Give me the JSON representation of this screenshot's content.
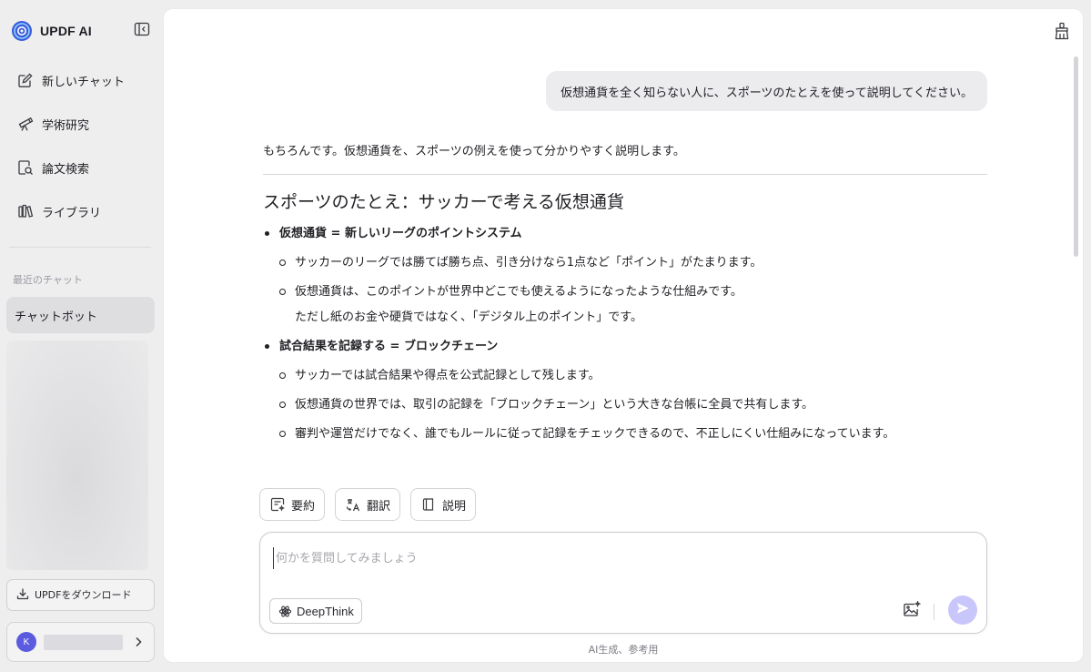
{
  "app": {
    "name": "UPDF AI"
  },
  "sidebar": {
    "nav": [
      {
        "label": "新しいチャット",
        "icon": "edit-icon"
      },
      {
        "label": "学術研究",
        "icon": "telescope-icon"
      },
      {
        "label": "論文検索",
        "icon": "document-search-icon"
      },
      {
        "label": "ライブラリ",
        "icon": "library-icon"
      }
    ],
    "recent_label": "最近のチャット",
    "recent_chats": [
      "チャットボット"
    ],
    "download_label": "UPDFをダウンロード",
    "account": {
      "avatar_initial": "K"
    }
  },
  "chat": {
    "user_message": "仮想通貨を全く知らない人に、スポーツのたとえを使って説明してください。",
    "assistant": {
      "intro": "もちろんです。仮想通貨を、スポーツの例えを使って分かりやすく説明します。",
      "section_title": "スポーツのたとえ：サッカーで考える仮想通貨",
      "bullets": [
        {
          "title": "仮想通貨 = 新しいリーグのポイントシステム",
          "subs": [
            {
              "text": "サッカーのリーグでは勝てば勝ち点、引き分けなら1点など「ポイント」がたまります。",
              "cont": ""
            },
            {
              "text": "仮想通貨は、このポイントが世界中どこでも使えるようになったような仕組みです。",
              "cont": "ただし紙のお金や硬貨ではなく、「デジタル上のポイント」です。"
            }
          ]
        },
        {
          "title": "試合結果を記録する = ブロックチェーン",
          "subs": [
            {
              "text": "サッカーでは試合結果や得点を公式記録として残します。",
              "cont": ""
            },
            {
              "text": "仮想通貨の世界では、取引の記録を「ブロックチェーン」という大きな台帳に全員で共有します。",
              "cont": ""
            },
            {
              "text": "審判や運営だけでなく、誰でもルールに従って記録をチェックできるので、不正しにくい仕組みになっています。",
              "cont": ""
            }
          ]
        }
      ]
    }
  },
  "quick_actions": [
    {
      "label": "要約",
      "icon": "summary-icon"
    },
    {
      "label": "翻訳",
      "icon": "translate-icon"
    },
    {
      "label": "説明",
      "icon": "book-icon"
    }
  ],
  "composer": {
    "placeholder": "何かを質問してみましょう",
    "value": "",
    "deepthink_label": "DeepThink"
  },
  "footer_note": "AI生成、参考用",
  "colors": {
    "accent": "#c9c6fb",
    "avatar": "#5b5be0",
    "logo": "#3b5bdb"
  }
}
